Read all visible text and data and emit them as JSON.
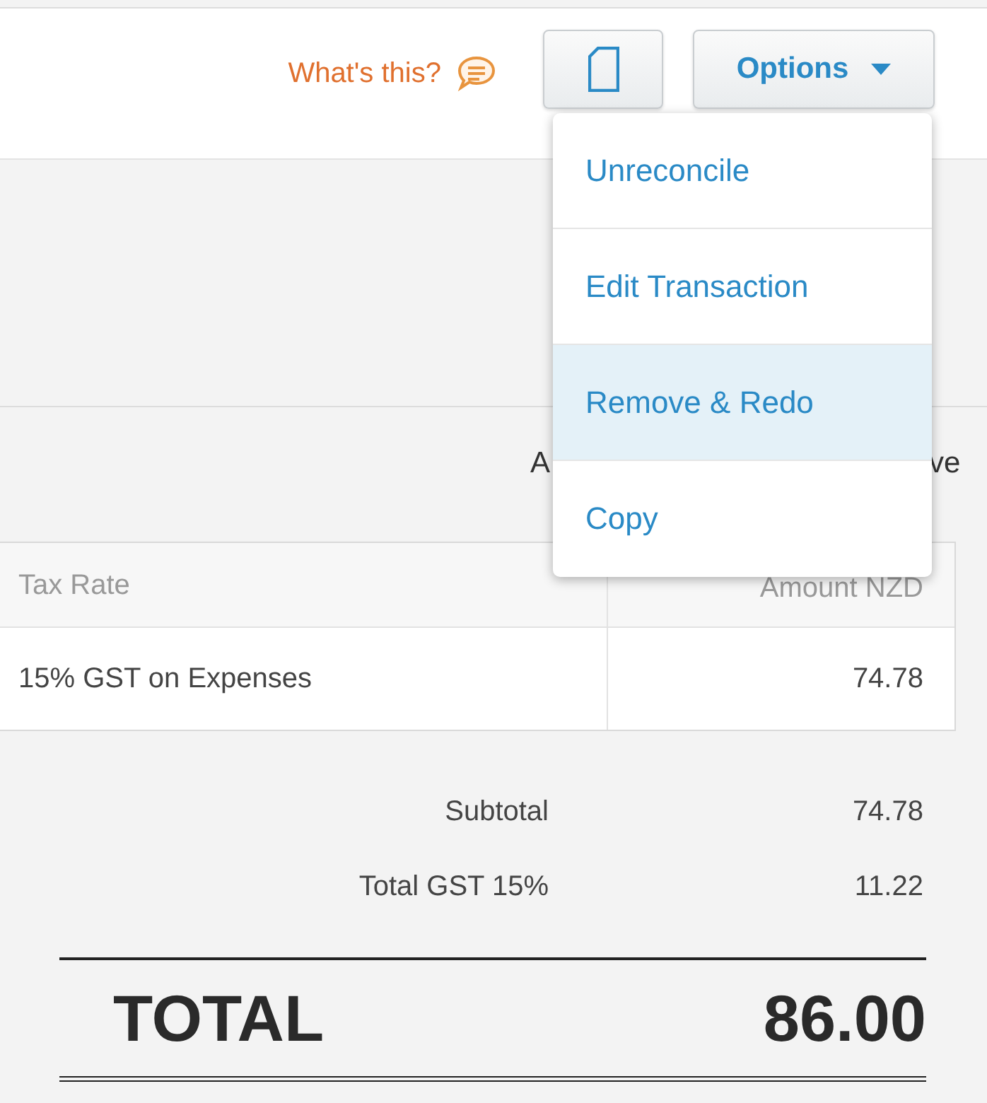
{
  "header": {
    "help_link": "What's this?",
    "options_button": "Options"
  },
  "options_menu": [
    {
      "label": "Unreconcile",
      "selected": false
    },
    {
      "label": "Edit Transaction",
      "selected": false
    },
    {
      "label": "Remove & Redo",
      "selected": true
    },
    {
      "label": "Copy",
      "selected": false
    }
  ],
  "partial_texts": [
    "A",
    "ve"
  ],
  "table": {
    "columns": [
      "Tax Rate",
      "Amount NZD"
    ],
    "rows": [
      [
        "15% GST on Expenses",
        "74.78"
      ]
    ]
  },
  "totals": [
    {
      "label": "Subtotal",
      "value": "74.78"
    },
    {
      "label": "Total GST 15%",
      "value": "11.22"
    }
  ],
  "grand_total": {
    "label": "TOTAL",
    "value": "86.00"
  }
}
